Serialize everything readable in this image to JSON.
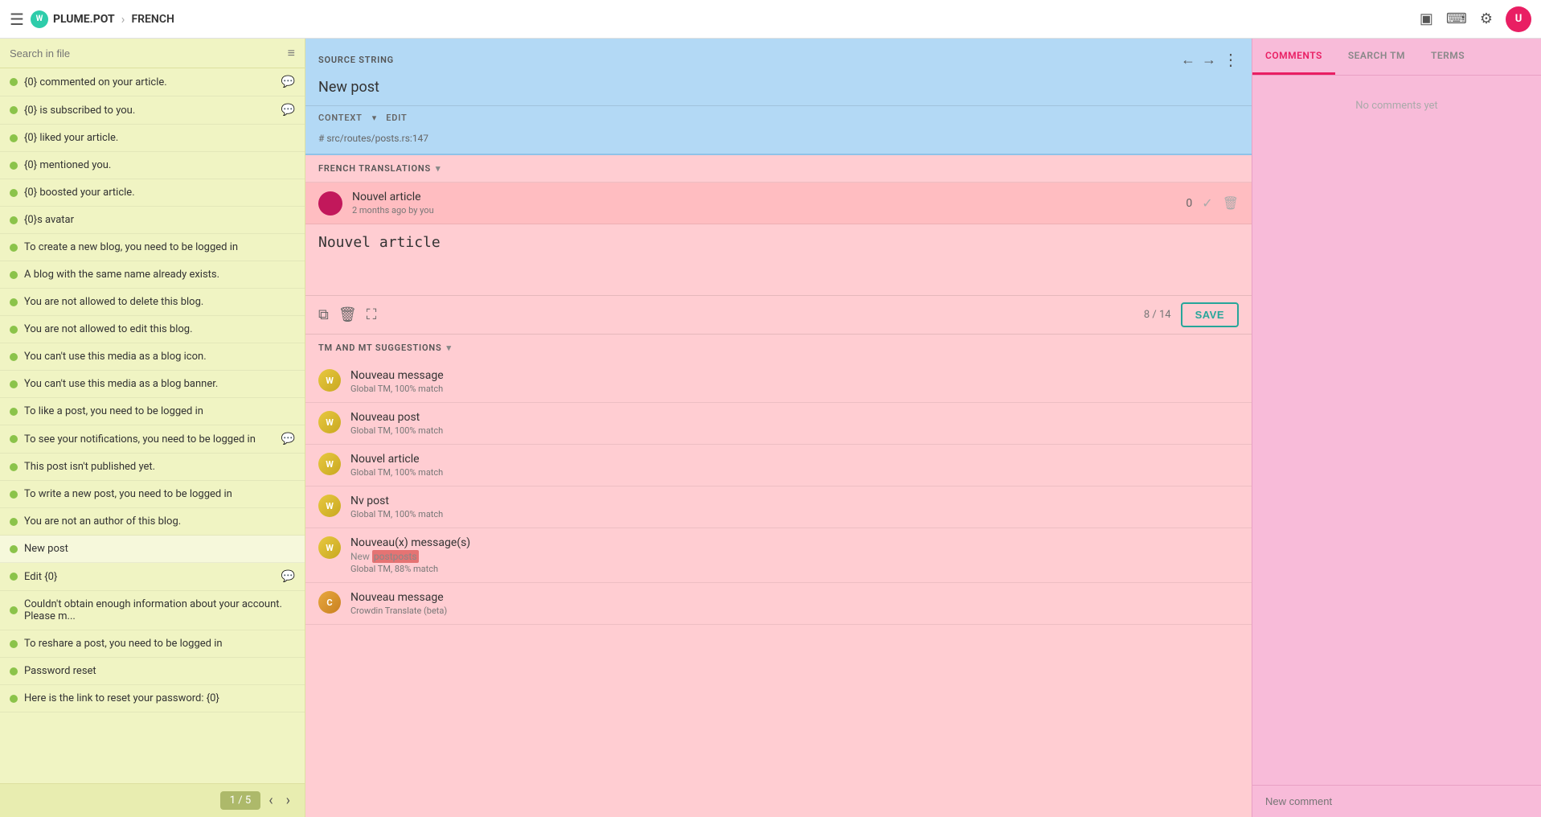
{
  "nav": {
    "menu_label": "☰",
    "logo_text": "PLUME.POT",
    "chevron": "›",
    "project": "FRENCH",
    "icons": {
      "layout": "▣",
      "keyboard": "⌨",
      "settings": "⚙"
    },
    "avatar_initials": "U"
  },
  "left_panel": {
    "search_placeholder": "Search in file",
    "items": [
      {
        "text": "{0} commented on your article.",
        "has_comment": true
      },
      {
        "text": "{0} is subscribed to you.",
        "has_comment": true
      },
      {
        "text": "{0} liked your article.",
        "has_comment": false
      },
      {
        "text": "{0} mentioned you.",
        "has_comment": false
      },
      {
        "text": "{0} boosted your article.",
        "has_comment": false
      },
      {
        "text": "{0}s avatar",
        "has_comment": false
      },
      {
        "text": "To create a new blog, you need to be logged in",
        "has_comment": false
      },
      {
        "text": "A blog with the same name already exists.",
        "has_comment": false
      },
      {
        "text": "You are not allowed to delete this blog.",
        "has_comment": false
      },
      {
        "text": "You are not allowed to edit this blog.",
        "has_comment": false
      },
      {
        "text": "You can't use this media as a blog icon.",
        "has_comment": false
      },
      {
        "text": "You can't use this media as a blog banner.",
        "has_comment": false
      },
      {
        "text": "To like a post, you need to be logged in",
        "has_comment": false
      },
      {
        "text": "To see your notifications, you need to be logged in",
        "has_comment": true
      },
      {
        "text": "This post isn't published yet.",
        "has_comment": false
      },
      {
        "text": "To write a new post, you need to be logged in",
        "has_comment": false
      },
      {
        "text": "You are not an author of this blog.",
        "has_comment": false
      },
      {
        "text": "New post",
        "has_comment": false,
        "active": true
      },
      {
        "text": "Edit {0}",
        "has_comment": true
      },
      {
        "text": "Couldn't obtain enough information about your account. Please m...",
        "has_comment": false
      },
      {
        "text": "To reshare a post, you need to be logged in",
        "has_comment": false
      },
      {
        "text": "Password reset",
        "has_comment": false
      },
      {
        "text": "Here is the link to reset your password: {0}",
        "has_comment": false
      }
    ],
    "pagination": {
      "label": "1 / 5",
      "prev": "‹",
      "next": "›"
    }
  },
  "source_panel": {
    "label": "SOURCE STRING",
    "text": "New post",
    "context_label": "CONTEXT",
    "context_dropdown": "▾",
    "edit_label": "EDIT",
    "filepath": "# src/routes/posts.rs:147",
    "nav_prev": "←",
    "nav_next": "→",
    "more_icon": "⋮"
  },
  "translation_panel": {
    "current_translation": "Nouvel article",
    "char_count": "8 / 14",
    "save_label": "SAVE",
    "toolbar_copy": "⧉",
    "toolbar_delete": "🗑",
    "toolbar_fullscreen": "⛶",
    "translations_header": "FRENCH TRANSLATIONS",
    "translations_dropdown": "▾",
    "translations": [
      {
        "avatar_type": "user",
        "avatar_color": "#c2185b",
        "text": "Nouvel article",
        "meta": "2 months ago by you",
        "votes": "0",
        "approved": false
      }
    ],
    "suggestions_header": "TM AND MT SUGGESTIONS",
    "suggestions_dropdown": "▾",
    "suggestions": [
      {
        "text": "Nouveau message",
        "meta": "Global TM, 100% match",
        "highlight": null
      },
      {
        "text": "Nouveau post",
        "meta": "Global TM, 100% match",
        "highlight": null
      },
      {
        "text": "Nouvel article",
        "meta": "Global TM, 100% match",
        "highlight": null
      },
      {
        "text": "Nv post",
        "meta": "Global TM, 100% match",
        "highlight": null
      },
      {
        "text_parts": [
          "Nouveau(x) message(s)",
          "New ",
          "postposts"
        ],
        "meta": "Global TM, 88% match",
        "highlight": "postposts",
        "text": "Nouveau(x) message(s)",
        "subtext": "New postposts"
      },
      {
        "text": "Nouveau message",
        "meta": "Crowdin Translate (beta)",
        "highlight": null,
        "is_crowdin": true
      }
    ]
  },
  "right_panel": {
    "tabs": [
      {
        "label": "COMMENTS",
        "active": true
      },
      {
        "label": "SEARCH TM",
        "active": false
      },
      {
        "label": "TERMS",
        "active": false
      }
    ],
    "empty_text": "No comments yet",
    "new_comment_placeholder": "New comment"
  }
}
